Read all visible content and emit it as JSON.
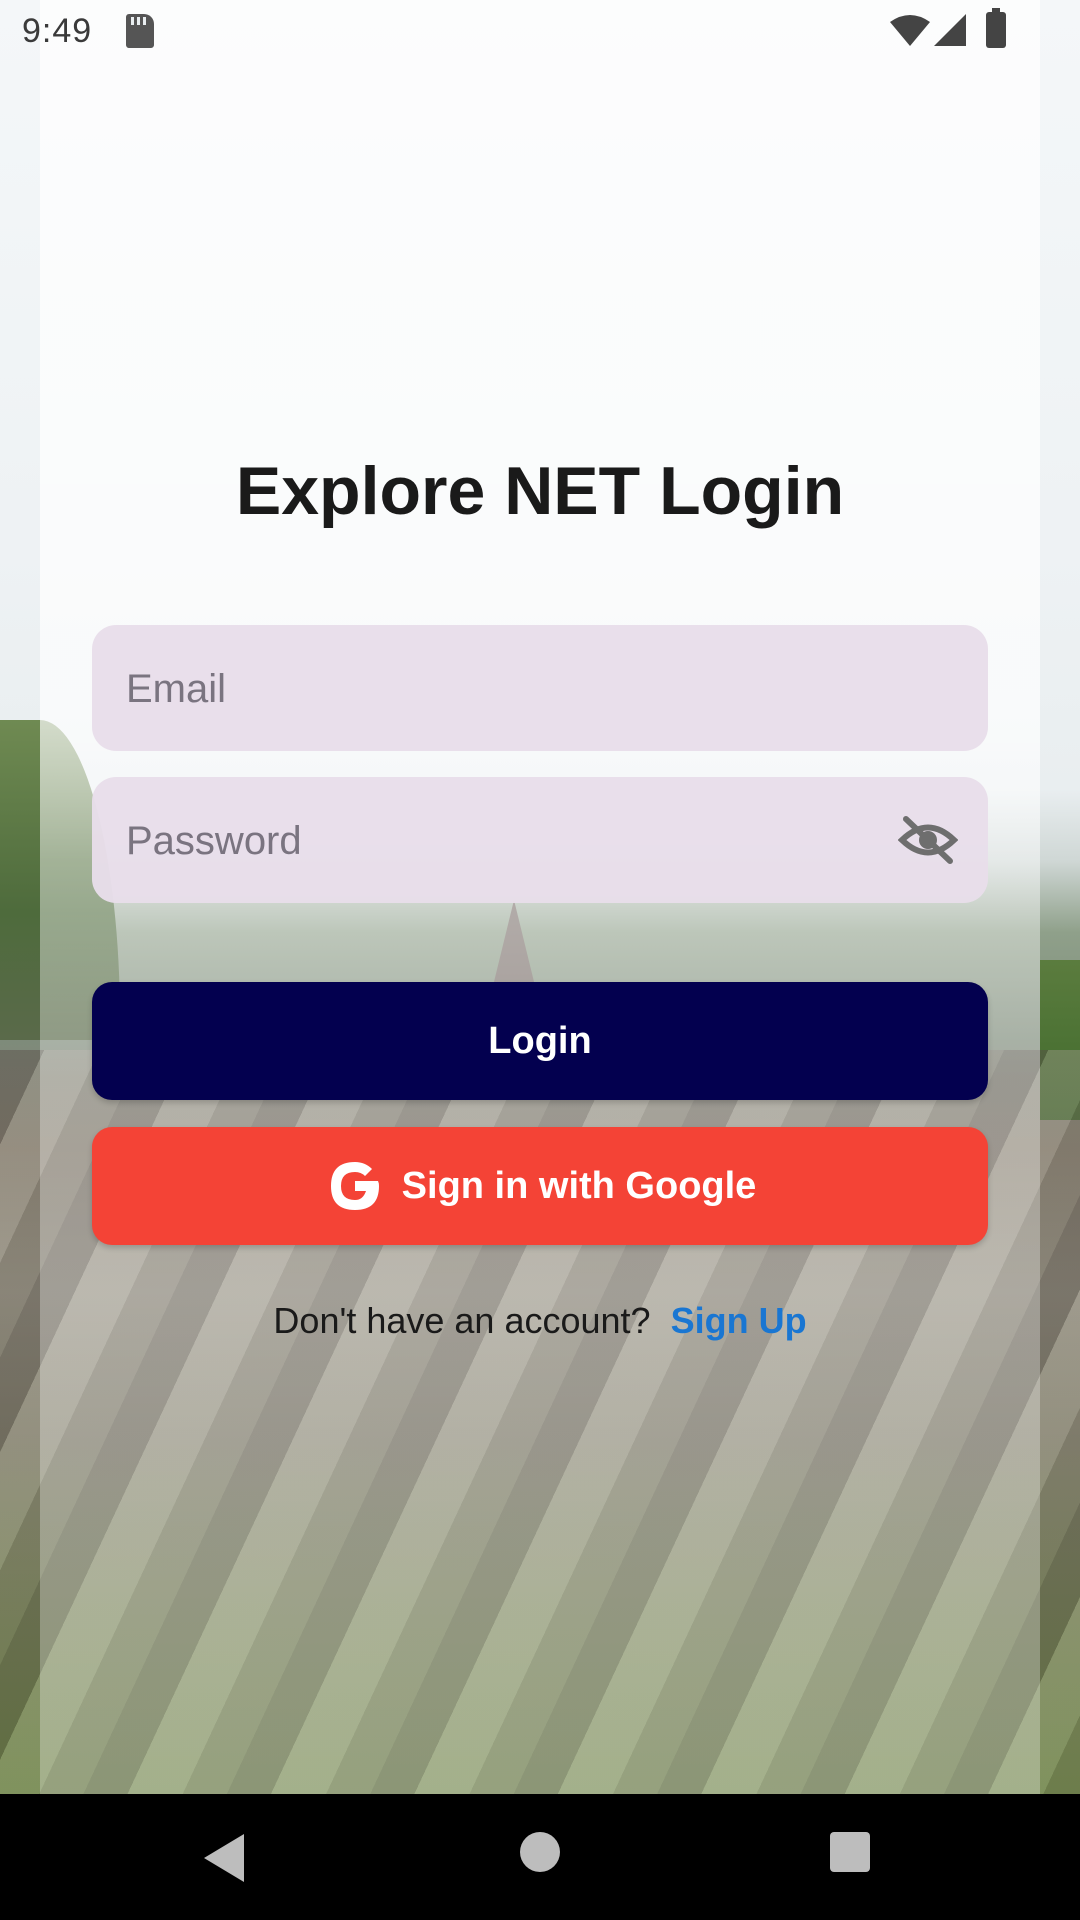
{
  "status_bar": {
    "time": "9:49"
  },
  "title": "Explore NET Login",
  "form": {
    "email_placeholder": "Email",
    "password_placeholder": "Password"
  },
  "buttons": {
    "login_label": "Login",
    "google_label": "Sign in with Google"
  },
  "signup": {
    "prompt": "Don't have an account?",
    "link": "Sign Up"
  },
  "icons": {
    "status": [
      "sd-card-icon",
      "wifi-icon",
      "signal-icon",
      "battery-icon"
    ],
    "password_toggle": "eye-off-icon",
    "google": "google-g-icon",
    "nav": [
      "back-icon",
      "home-icon",
      "recents-icon"
    ]
  },
  "colors": {
    "login_button": "#03004f",
    "google_button": "#f44336",
    "signup_link": "#1976d2",
    "input_fill": "#e8deea"
  }
}
